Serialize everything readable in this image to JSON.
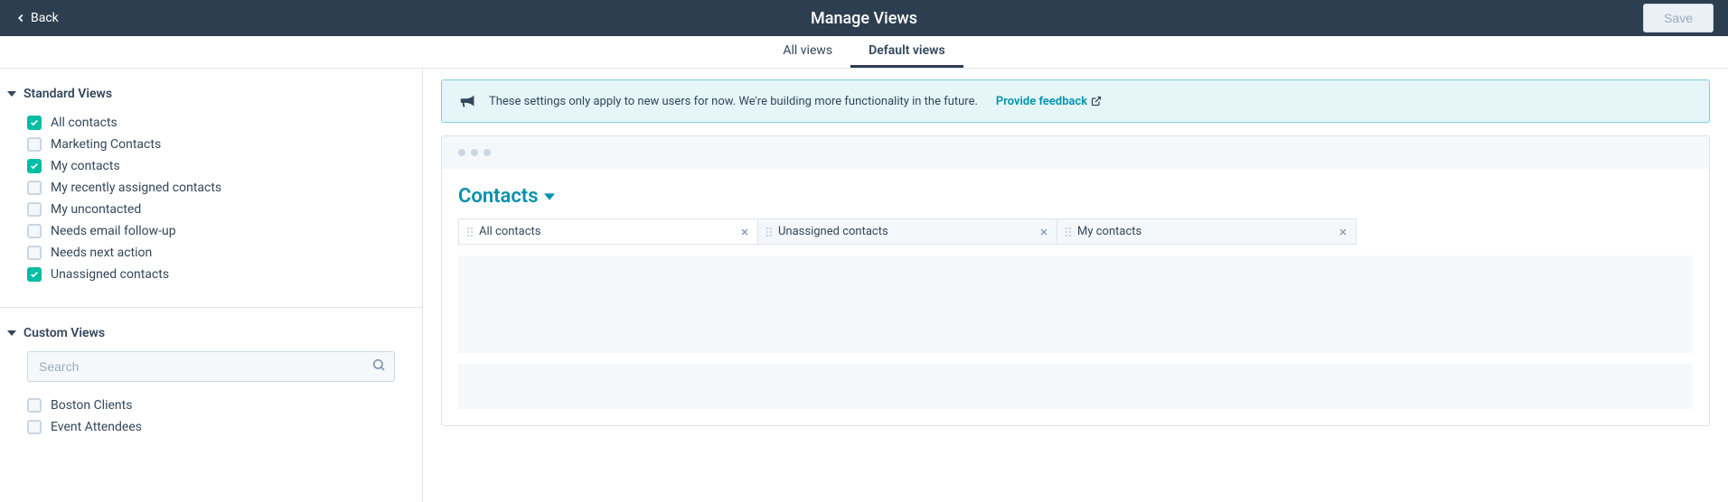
{
  "header": {
    "back": "Back",
    "title": "Manage Views",
    "save": "Save"
  },
  "tabs": {
    "all": "All views",
    "default": "Default views"
  },
  "sidebar": {
    "standard_title": "Standard Views",
    "standard": [
      {
        "label": "All contacts",
        "checked": true
      },
      {
        "label": "Marketing Contacts",
        "checked": false
      },
      {
        "label": "My contacts",
        "checked": true
      },
      {
        "label": "My recently assigned contacts",
        "checked": false
      },
      {
        "label": "My uncontacted",
        "checked": false
      },
      {
        "label": "Needs email follow-up",
        "checked": false
      },
      {
        "label": "Needs next action",
        "checked": false
      },
      {
        "label": "Unassigned contacts",
        "checked": true
      }
    ],
    "custom_title": "Custom Views",
    "search_placeholder": "Search",
    "custom": [
      {
        "label": "Boston Clients",
        "checked": false
      },
      {
        "label": "Event Attendees",
        "checked": false
      }
    ]
  },
  "content": {
    "banner_text": "These settings only apply to new users for now. We're building more functionality in the future.",
    "banner_link": "Provide feedback",
    "contacts_title": "Contacts",
    "view_tabs": [
      {
        "label": "All contacts"
      },
      {
        "label": "Unassigned contacts"
      },
      {
        "label": "My contacts"
      }
    ]
  }
}
